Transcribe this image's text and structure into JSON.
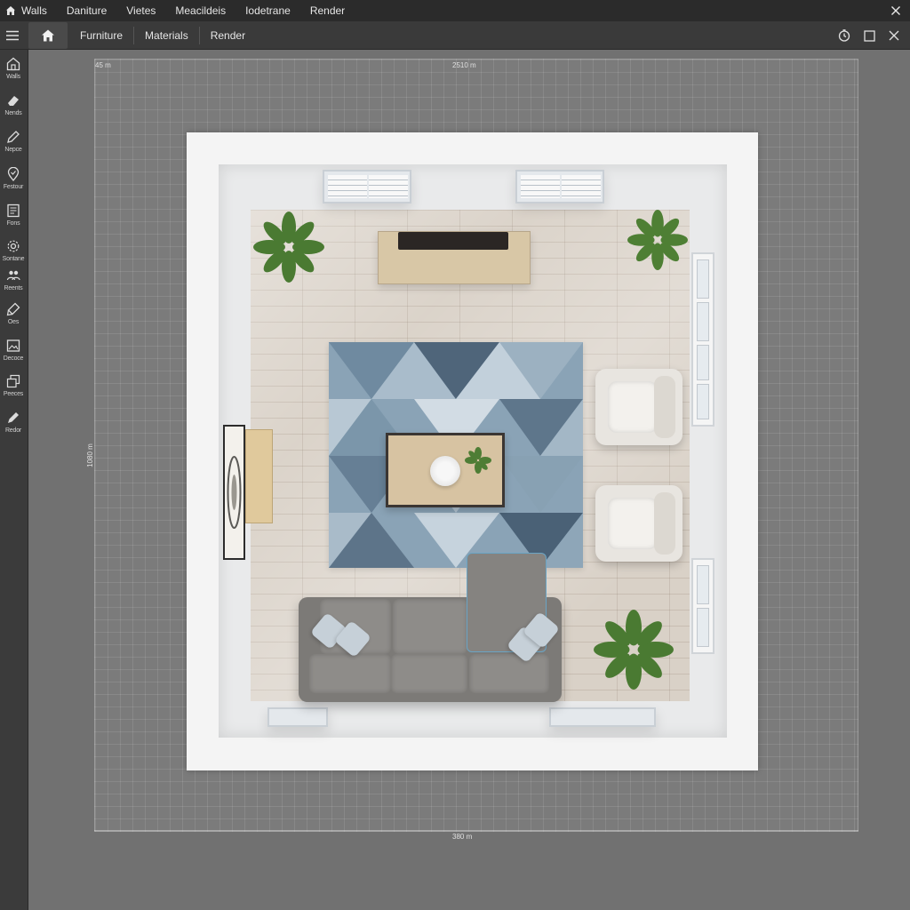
{
  "menubar": {
    "items": [
      {
        "label": "Walls"
      },
      {
        "label": "Daniture"
      },
      {
        "label": "Vietes"
      },
      {
        "label": "Meacildeis"
      },
      {
        "label": "Iodetrane"
      },
      {
        "label": "Render"
      }
    ]
  },
  "toolbar": {
    "tabs": [
      {
        "label": "Furniture"
      },
      {
        "label": "Materials"
      },
      {
        "label": "Render"
      }
    ]
  },
  "sidebar": {
    "tools": [
      {
        "label": "Walls",
        "icon": "home-icon"
      },
      {
        "label": "Nends",
        "icon": "eraser-icon"
      },
      {
        "label": "Nepce",
        "icon": "pencil-icon"
      },
      {
        "label": "Festour",
        "icon": "location-pin-icon"
      },
      {
        "label": "Fons",
        "icon": "document-icon"
      },
      {
        "label": "Sontane",
        "icon": "settings-icon"
      },
      {
        "label": "Reents",
        "icon": "people-icon"
      },
      {
        "label": "Oes",
        "icon": "brush-icon"
      },
      {
        "label": "Decoce",
        "icon": "picture-icon"
      },
      {
        "label": "Peeces",
        "icon": "layers-icon"
      },
      {
        "label": "Redor",
        "icon": "pen-icon"
      }
    ]
  },
  "canvas": {
    "dim_top_left": "45 m",
    "dim_top": "2510 m",
    "dim_left": "1080 m",
    "dim_bottom": "380 m"
  },
  "colors": {
    "menubar": "#2b2b2b",
    "toolbar": "#3a3a3a",
    "sidebar": "#3b3b3b",
    "canvas": "#717171",
    "floor": "#d9d1c7",
    "sofa": "#7c7a77",
    "rug": "#8fa6b8",
    "selection": "#6aa4c4"
  }
}
